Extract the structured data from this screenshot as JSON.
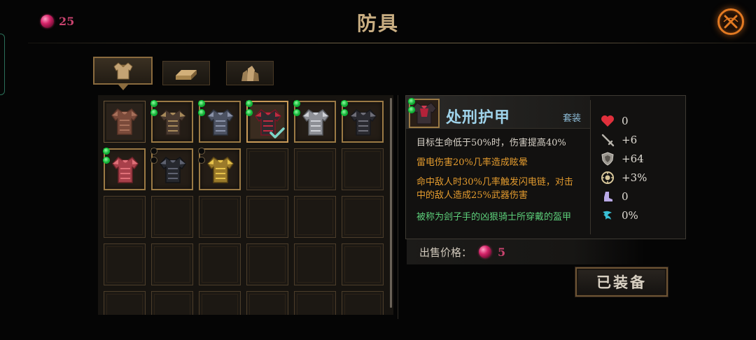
{
  "header": {
    "currency_value": "25",
    "title": "防具"
  },
  "colors": {
    "accent_gold": "#c9ae82",
    "gem_pink": "#c8436e",
    "name_blue": "#9fd3ea",
    "effect_orange": "#e39b2e",
    "lore_green": "#5ccf7a",
    "close_orange": "#e37a22"
  },
  "category_tabs": [
    {
      "icon": "armor-icon",
      "active": true
    },
    {
      "icon": "ingot-icon",
      "active": false
    },
    {
      "icon": "ore-icon",
      "active": false
    }
  ],
  "inventory": {
    "slots": [
      {
        "armor": "leather",
        "dots": [],
        "state": "plain"
      },
      {
        "armor": "brown-plate",
        "dots": [
          "g",
          "g"
        ],
        "state": "item"
      },
      {
        "armor": "steel-plate",
        "dots": [
          "g",
          "g"
        ],
        "state": "item"
      },
      {
        "armor": "executioner",
        "dots": [
          "g",
          "g"
        ],
        "state": "selected",
        "equipped": true
      },
      {
        "armor": "silver-plate",
        "dots": [
          "g",
          "g"
        ],
        "state": "item"
      },
      {
        "armor": "dark-plate",
        "dots": [
          "g",
          "g"
        ],
        "state": "item"
      },
      {
        "armor": "crimson",
        "dots": [
          "g",
          "g"
        ],
        "state": "item"
      },
      {
        "armor": "black-spiked",
        "dots": [
          "e",
          "e"
        ],
        "state": "item"
      },
      {
        "armor": "golden",
        "dots": [
          "e",
          "e"
        ],
        "state": "item"
      }
    ],
    "total_slots": 30
  },
  "detail": {
    "name": "处刑护甲",
    "set_label": "套装",
    "effect_1": "目标生命低于50%时，伤害提高40%",
    "effect_2": "雷电伤害20%几率造成眩晕",
    "effect_3_line1": "命中敌人时30%几率触发闪电链，对击",
    "effect_3_line2": "中的敌人造成25%武器伤害",
    "lore": "被称为刽子手的凶狠骑士所穿戴的盔甲",
    "stats": [
      {
        "icon": "heart-icon",
        "value": "0"
      },
      {
        "icon": "sword-icon",
        "value": "+6"
      },
      {
        "icon": "shield-icon",
        "value": "+64"
      },
      {
        "icon": "crit-icon",
        "value": "+3%"
      },
      {
        "icon": "boot-icon",
        "value": "0"
      },
      {
        "icon": "dodge-icon",
        "value": "0%"
      }
    ]
  },
  "price": {
    "label": "出售价格：",
    "value": "5"
  },
  "equip_button": {
    "label": "已装备"
  }
}
